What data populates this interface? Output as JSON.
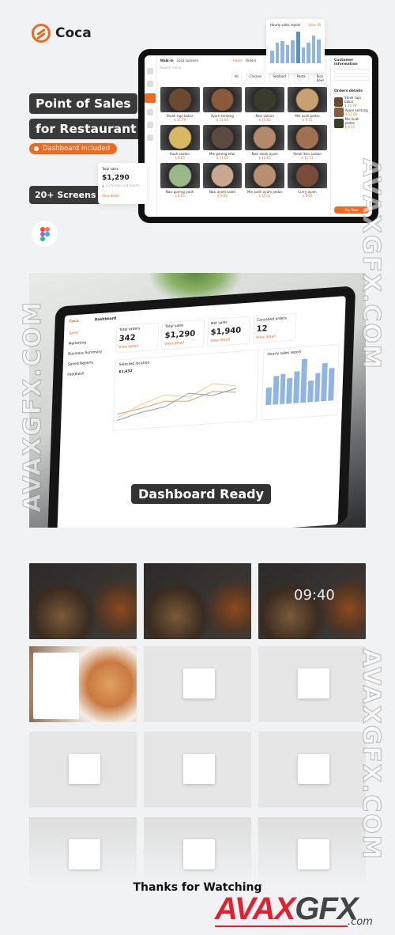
{
  "brand": {
    "name": "Coca",
    "accent": "#ee6a1f"
  },
  "hero": {
    "line1": "Point of Sales",
    "line2": "for Restaurant",
    "badge": "Dashboard included",
    "screens": "20+ Screens",
    "figma_icon": "figma-logo"
  },
  "hourly": {
    "title": "Hourly sales report",
    "link": "View All",
    "tip": "$12k",
    "bars": [
      40,
      65,
      70,
      58,
      72,
      100,
      50,
      66,
      88,
      74
    ]
  },
  "total_sales": {
    "title": "Total sales",
    "value": "$1,290",
    "sub": "▲ 3.2% than last month",
    "link": "View detail"
  },
  "pos": {
    "order_type": "Walk-in",
    "customer": "Coca Lumiere",
    "tabs": [
      "Home",
      "Orders"
    ],
    "search": "Search menu...",
    "chips": [
      "All",
      "Chicken",
      "Seafood",
      "Pasta",
      "Rice bowl"
    ],
    "items": [
      {
        "name": "Steak sapi bakar",
        "price": "$ 15.79"
      },
      {
        "name": "Ayam kentang",
        "price": "$ 11.65"
      },
      {
        "name": "Nasi santan",
        "price": "$ 10.65"
      },
      {
        "name": "Mie kuah pedas",
        "price": "$ 9.11"
      },
      {
        "name": "Kuah santan",
        "price": "$ 8.65"
      },
      {
        "name": "Mie goreng telor",
        "price": "$ 11.65"
      },
      {
        "name": "Nasi steak ayam",
        "price": "$ 12.65"
      },
      {
        "name": "Steak ikan santan",
        "price": "$ 11.11"
      },
      {
        "name": "Nasi goreng putih",
        "price": "$ 8.65"
      },
      {
        "name": "Nasi ayam salad",
        "price": "$ 9.65"
      },
      {
        "name": "Mie putih ayam pedas",
        "price": "$ 10.11"
      },
      {
        "name": "Curry ayam",
        "price": "$ 8.65"
      }
    ],
    "customer_title": "Customer information",
    "orders_title": "Orders details",
    "orders": [
      {
        "name": "Steak sapi bakar",
        "price": "$ 15.79"
      },
      {
        "name": "Ayam kentang",
        "price": "$ 11.65"
      },
      {
        "name": "Mie kuah pedas",
        "price": "$ 9.11"
      }
    ],
    "pay": "Pay Now"
  },
  "dashboard": {
    "title": "Dashboard",
    "menu": [
      "Sales",
      "Marketing",
      "Business Summary",
      "Saved Reports",
      "Feedback"
    ],
    "stats": [
      {
        "label": "Total orders",
        "value": "342",
        "link": "View detail"
      },
      {
        "label": "Total sales",
        "value": "$1,290",
        "link": "View detail"
      },
      {
        "label": "Net sales",
        "value": "$1,940",
        "link": "View detail"
      },
      {
        "label": "Cancelled orders",
        "value": "12",
        "link": "View detail"
      }
    ],
    "chart_title": "Selected location",
    "location_value": "$1,432",
    "hourly": "Hourly sales report"
  },
  "dashboard_label": "Dashboard Ready",
  "thumbs": {
    "clock": "09:40"
  },
  "thanks": "Thanks for Watching",
  "watermark": {
    "a": "AVAX",
    "b": "GFX",
    "c": ".com",
    "vertical": "AVAXGFX.COM"
  }
}
